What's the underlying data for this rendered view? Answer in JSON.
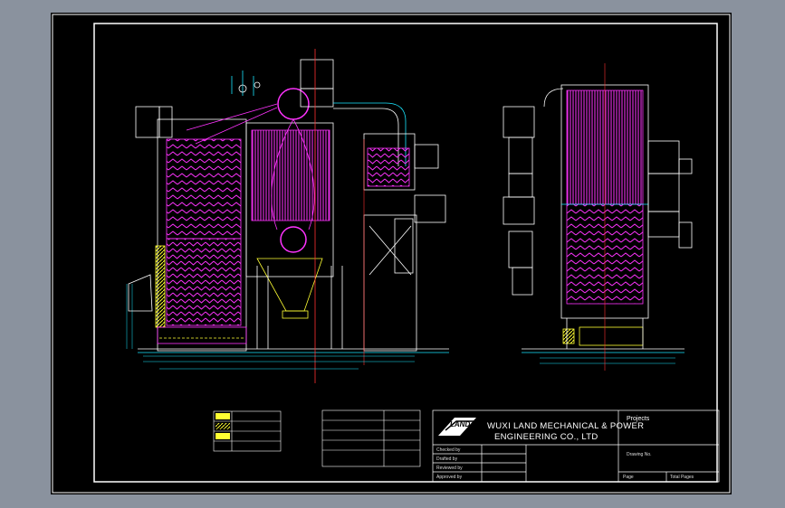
{
  "title_block": {
    "company_line1": "WUXI LAND MECHANICAL & POWER",
    "company_line2": "ENGINEERING CO., LTD",
    "logo_text": "LAND",
    "projects_label": "Projects",
    "drawing_no_label": "Drawing No.",
    "page_label": "Page",
    "total_pages_label": "Total Pages",
    "checked_by_label": "Checked by",
    "designed_by_label": "Drafted by",
    "reviewed_by_label": "Reviewed by",
    "approved_by_label": "Approved by"
  },
  "colors": {
    "sheet_border": "#ffffff",
    "drawing_lines": "#ffffff",
    "cyan": "#19e6ff",
    "magenta": "#ff33ff",
    "yellow": "#ffff33",
    "red": "#ff3030",
    "green": "#3dff3d"
  }
}
